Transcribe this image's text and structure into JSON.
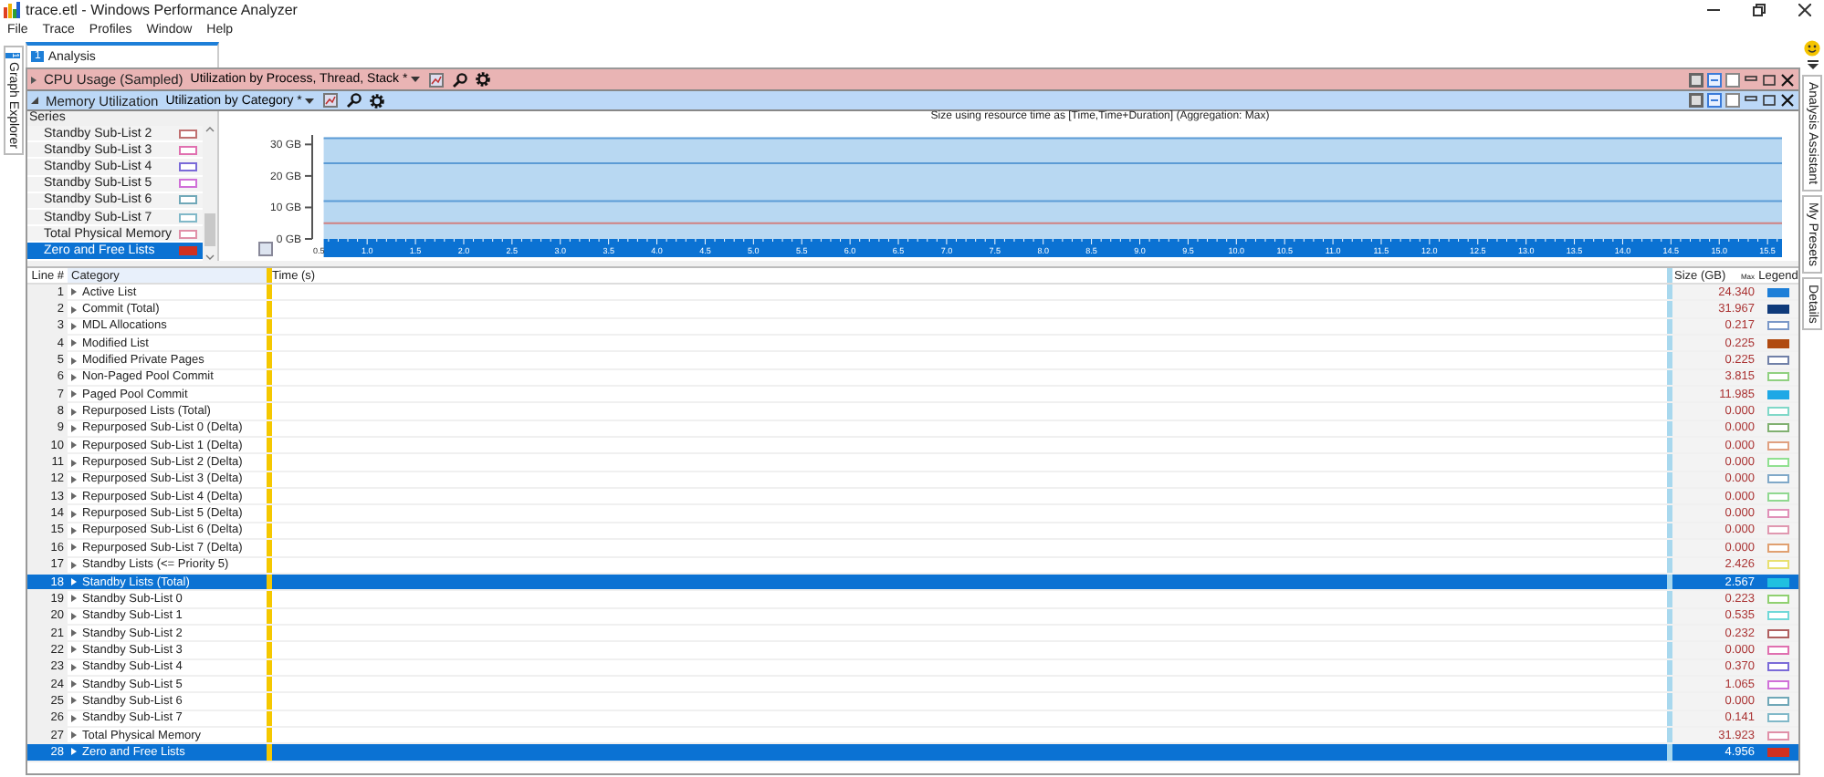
{
  "window": {
    "title": "trace.etl - Windows Performance Analyzer",
    "menu": [
      "File",
      "Trace",
      "Profiles",
      "Window",
      "Help"
    ]
  },
  "left_tabs": [
    {
      "label": "Graph Explorer",
      "number": "1"
    }
  ],
  "right_tabs": [
    "Analysis Assistant",
    "My Presets",
    "Details"
  ],
  "analysis_tab": {
    "number": "1",
    "label": "Analysis",
    "selected": true
  },
  "graphs": [
    {
      "title": "CPU Usage (Sampled)",
      "preset": "Utilization by Process, Thread, Stack *",
      "expanded": false,
      "color": "#e9b4b4"
    },
    {
      "title": "Memory Utilization",
      "preset": "Utilization by Category *",
      "expanded": true,
      "color": "#bcd8f7"
    }
  ],
  "series_panel": {
    "heading": "Series",
    "items": [
      {
        "label": "Standby Sub-List 2",
        "color": "#c07070",
        "kind": "outline",
        "selected": false
      },
      {
        "label": "Standby Sub-List 3",
        "color": "#e070b0",
        "kind": "outline",
        "selected": false
      },
      {
        "label": "Standby Sub-List 4",
        "color": "#7a6ad8",
        "kind": "outline",
        "selected": false
      },
      {
        "label": "Standby Sub-List 5",
        "color": "#d070d8",
        "kind": "outline",
        "selected": false
      },
      {
        "label": "Standby Sub-List 6",
        "color": "#70a8b8",
        "kind": "outline",
        "selected": false
      },
      {
        "label": "Standby Sub-List 7",
        "color": "#80b8c8",
        "kind": "outline",
        "selected": false
      },
      {
        "label": "Total Physical Memory",
        "color": "#e090a8",
        "kind": "outline",
        "selected": false
      },
      {
        "label": "Zero and Free Lists",
        "color": "#d03020",
        "kind": "solid",
        "selected": true
      }
    ]
  },
  "chart": {
    "subtitle": "Size using resource time as [Time,Time+Duration] (Aggregation: Max)",
    "chart_data": {
      "type": "line",
      "x": [
        0.55,
        15.65
      ],
      "xlim": [
        0.45,
        15.65
      ],
      "ylim": [
        0,
        33
      ],
      "series": [
        {
          "color": "#5b9bd5",
          "values": [
            32,
            32
          ]
        },
        {
          "color": "#5b9bd5",
          "values": [
            24,
            24
          ]
        },
        {
          "color": "#5b9bd5",
          "values": [
            12,
            12
          ]
        },
        {
          "color": "#d08080",
          "values": [
            5,
            5
          ]
        }
      ],
      "yticks": [
        {
          "value": 0,
          "label": "0 GB"
        },
        {
          "value": 10,
          "label": "10 GB"
        },
        {
          "value": 20,
          "label": "20 GB"
        },
        {
          "value": 30,
          "label": "30 GB"
        }
      ],
      "xticks": [
        {
          "value": 0.5,
          "label": "0.5"
        },
        {
          "value": 1,
          "label": "1.0"
        },
        {
          "value": 1.5,
          "label": "1.5"
        },
        {
          "value": 2,
          "label": "2.0"
        },
        {
          "value": 2.5,
          "label": "2.5"
        },
        {
          "value": 3,
          "label": "3.0"
        },
        {
          "value": 3.5,
          "label": "3.5"
        },
        {
          "value": 4,
          "label": "4.0"
        },
        {
          "value": 4.5,
          "label": "4.5"
        },
        {
          "value": 5,
          "label": "5.0"
        },
        {
          "value": 5.5,
          "label": "5.5"
        },
        {
          "value": 6,
          "label": "6.0"
        },
        {
          "value": 6.5,
          "label": "6.5"
        },
        {
          "value": 7,
          "label": "7.0"
        },
        {
          "value": 7.5,
          "label": "7.5"
        },
        {
          "value": 8,
          "label": "8.0"
        },
        {
          "value": 8.5,
          "label": "8.5"
        },
        {
          "value": 9,
          "label": "9.0"
        },
        {
          "value": 9.5,
          "label": "9.5"
        },
        {
          "value": 10,
          "label": "10.0"
        },
        {
          "value": 10.5,
          "label": "10.5"
        },
        {
          "value": 11,
          "label": "11.0"
        },
        {
          "value": 11.5,
          "label": "11.5"
        },
        {
          "value": 12,
          "label": "12.0"
        },
        {
          "value": 12.5,
          "label": "12.5"
        },
        {
          "value": 13,
          "label": "13.0"
        },
        {
          "value": 13.5,
          "label": "13.5"
        },
        {
          "value": 14,
          "label": "14.0"
        },
        {
          "value": 14.5,
          "label": "14.5"
        },
        {
          "value": 15,
          "label": "15.0"
        },
        {
          "value": 15.5,
          "label": "15.5"
        }
      ]
    }
  },
  "table": {
    "columns": {
      "line": "Line #",
      "category": "Category",
      "time": "Time (s)",
      "size": "Size (GB)",
      "size_aggregation": "Max",
      "legend": "Legend"
    },
    "rows": [
      {
        "line": "1",
        "category": "Active List",
        "size": "24.340",
        "color": "#1e7fd8",
        "kind": "solid",
        "selected": false
      },
      {
        "line": "2",
        "category": "Commit (Total)",
        "size": "31.967",
        "color": "#0f3a7a",
        "kind": "solid",
        "selected": false
      },
      {
        "line": "3",
        "category": "MDL Allocations",
        "size": "0.217",
        "color": "#7a98c8",
        "kind": "outline",
        "selected": false
      },
      {
        "line": "4",
        "category": "Modified List",
        "size": "0.225",
        "color": "#b04a10",
        "kind": "solid",
        "selected": false
      },
      {
        "line": "5",
        "category": "Modified Private Pages",
        "size": "0.225",
        "color": "#7080a8",
        "kind": "outline",
        "selected": false
      },
      {
        "line": "6",
        "category": "Non-Paged Pool Commit",
        "size": "3.815",
        "color": "#90d080",
        "kind": "outline",
        "selected": false
      },
      {
        "line": "7",
        "category": "Paged Pool Commit",
        "size": "11.985",
        "color": "#1ea8e6",
        "kind": "solid",
        "selected": false
      },
      {
        "line": "8",
        "category": "Repurposed Lists (Total)",
        "size": "0.000",
        "color": "#80d8c8",
        "kind": "outline",
        "selected": false
      },
      {
        "line": "9",
        "category": "Repurposed Sub-List 0 (Delta)",
        "size": "0.000",
        "color": "#80b070",
        "kind": "outline",
        "selected": false
      },
      {
        "line": "10",
        "category": "Repurposed Sub-List 1 (Delta)",
        "size": "0.000",
        "color": "#e0a080",
        "kind": "outline",
        "selected": false
      },
      {
        "line": "11",
        "category": "Repurposed Sub-List 2 (Delta)",
        "size": "0.000",
        "color": "#90e090",
        "kind": "outline",
        "selected": false
      },
      {
        "line": "12",
        "category": "Repurposed Sub-List 3 (Delta)",
        "size": "0.000",
        "color": "#80a8c8",
        "kind": "outline",
        "selected": false
      },
      {
        "line": "13",
        "category": "Repurposed Sub-List 4 (Delta)",
        "size": "0.000",
        "color": "#90d890",
        "kind": "outline",
        "selected": false
      },
      {
        "line": "14",
        "category": "Repurposed Sub-List 5 (Delta)",
        "size": "0.000",
        "color": "#e090b8",
        "kind": "outline",
        "selected": false
      },
      {
        "line": "15",
        "category": "Repurposed Sub-List 6 (Delta)",
        "size": "0.000",
        "color": "#e098b0",
        "kind": "outline",
        "selected": false
      },
      {
        "line": "16",
        "category": "Repurposed Sub-List 7 (Delta)",
        "size": "0.000",
        "color": "#e0a070",
        "kind": "outline",
        "selected": false
      },
      {
        "line": "17",
        "category": "Standby Lists (<= Priority 5)",
        "size": "2.426",
        "color": "#e8e070",
        "kind": "outline",
        "selected": false
      },
      {
        "line": "18",
        "category": "Standby Lists (Total)",
        "size": "2.567",
        "color": "#20c0e0",
        "kind": "solid",
        "selected": true
      },
      {
        "line": "19",
        "category": "Standby Sub-List 0",
        "size": "0.223",
        "color": "#90d070",
        "kind": "outline",
        "selected": false
      },
      {
        "line": "20",
        "category": "Standby Sub-List 1",
        "size": "0.535",
        "color": "#70d8d8",
        "kind": "outline",
        "selected": false
      },
      {
        "line": "21",
        "category": "Standby Sub-List 2",
        "size": "0.232",
        "color": "#b06060",
        "kind": "outline",
        "selected": false
      },
      {
        "line": "22",
        "category": "Standby Sub-List 3",
        "size": "0.000",
        "color": "#e070b0",
        "kind": "outline",
        "selected": false
      },
      {
        "line": "23",
        "category": "Standby Sub-List 4",
        "size": "0.370",
        "color": "#7a6ad8",
        "kind": "outline",
        "selected": false
      },
      {
        "line": "24",
        "category": "Standby Sub-List 5",
        "size": "1.065",
        "color": "#d070d8",
        "kind": "outline",
        "selected": false
      },
      {
        "line": "25",
        "category": "Standby Sub-List 6",
        "size": "0.000",
        "color": "#70a8b8",
        "kind": "outline",
        "selected": false
      },
      {
        "line": "26",
        "category": "Standby Sub-List 7",
        "size": "0.141",
        "color": "#80b8c8",
        "kind": "outline",
        "selected": false
      },
      {
        "line": "27",
        "category": "Total Physical Memory",
        "size": "31.923",
        "color": "#e090a8",
        "kind": "outline",
        "selected": false
      },
      {
        "line": "28",
        "category": "Zero and Free Lists",
        "size": "4.956",
        "color": "#d03020",
        "kind": "solid",
        "selected": true
      }
    ]
  }
}
